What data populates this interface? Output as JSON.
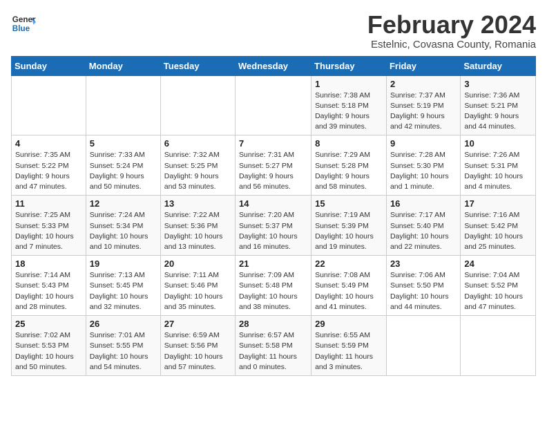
{
  "logo": {
    "line1": "General",
    "line2": "Blue"
  },
  "title": "February 2024",
  "subtitle": "Estelnic, Covasna County, Romania",
  "days_of_week": [
    "Sunday",
    "Monday",
    "Tuesday",
    "Wednesday",
    "Thursday",
    "Friday",
    "Saturday"
  ],
  "weeks": [
    [
      {
        "day": "",
        "info": ""
      },
      {
        "day": "",
        "info": ""
      },
      {
        "day": "",
        "info": ""
      },
      {
        "day": "",
        "info": ""
      },
      {
        "day": "1",
        "info": "Sunrise: 7:38 AM\nSunset: 5:18 PM\nDaylight: 9 hours\nand 39 minutes."
      },
      {
        "day": "2",
        "info": "Sunrise: 7:37 AM\nSunset: 5:19 PM\nDaylight: 9 hours\nand 42 minutes."
      },
      {
        "day": "3",
        "info": "Sunrise: 7:36 AM\nSunset: 5:21 PM\nDaylight: 9 hours\nand 44 minutes."
      }
    ],
    [
      {
        "day": "4",
        "info": "Sunrise: 7:35 AM\nSunset: 5:22 PM\nDaylight: 9 hours\nand 47 minutes."
      },
      {
        "day": "5",
        "info": "Sunrise: 7:33 AM\nSunset: 5:24 PM\nDaylight: 9 hours\nand 50 minutes."
      },
      {
        "day": "6",
        "info": "Sunrise: 7:32 AM\nSunset: 5:25 PM\nDaylight: 9 hours\nand 53 minutes."
      },
      {
        "day": "7",
        "info": "Sunrise: 7:31 AM\nSunset: 5:27 PM\nDaylight: 9 hours\nand 56 minutes."
      },
      {
        "day": "8",
        "info": "Sunrise: 7:29 AM\nSunset: 5:28 PM\nDaylight: 9 hours\nand 58 minutes."
      },
      {
        "day": "9",
        "info": "Sunrise: 7:28 AM\nSunset: 5:30 PM\nDaylight: 10 hours\nand 1 minute."
      },
      {
        "day": "10",
        "info": "Sunrise: 7:26 AM\nSunset: 5:31 PM\nDaylight: 10 hours\nand 4 minutes."
      }
    ],
    [
      {
        "day": "11",
        "info": "Sunrise: 7:25 AM\nSunset: 5:33 PM\nDaylight: 10 hours\nand 7 minutes."
      },
      {
        "day": "12",
        "info": "Sunrise: 7:24 AM\nSunset: 5:34 PM\nDaylight: 10 hours\nand 10 minutes."
      },
      {
        "day": "13",
        "info": "Sunrise: 7:22 AM\nSunset: 5:36 PM\nDaylight: 10 hours\nand 13 minutes."
      },
      {
        "day": "14",
        "info": "Sunrise: 7:20 AM\nSunset: 5:37 PM\nDaylight: 10 hours\nand 16 minutes."
      },
      {
        "day": "15",
        "info": "Sunrise: 7:19 AM\nSunset: 5:39 PM\nDaylight: 10 hours\nand 19 minutes."
      },
      {
        "day": "16",
        "info": "Sunrise: 7:17 AM\nSunset: 5:40 PM\nDaylight: 10 hours\nand 22 minutes."
      },
      {
        "day": "17",
        "info": "Sunrise: 7:16 AM\nSunset: 5:42 PM\nDaylight: 10 hours\nand 25 minutes."
      }
    ],
    [
      {
        "day": "18",
        "info": "Sunrise: 7:14 AM\nSunset: 5:43 PM\nDaylight: 10 hours\nand 28 minutes."
      },
      {
        "day": "19",
        "info": "Sunrise: 7:13 AM\nSunset: 5:45 PM\nDaylight: 10 hours\nand 32 minutes."
      },
      {
        "day": "20",
        "info": "Sunrise: 7:11 AM\nSunset: 5:46 PM\nDaylight: 10 hours\nand 35 minutes."
      },
      {
        "day": "21",
        "info": "Sunrise: 7:09 AM\nSunset: 5:48 PM\nDaylight: 10 hours\nand 38 minutes."
      },
      {
        "day": "22",
        "info": "Sunrise: 7:08 AM\nSunset: 5:49 PM\nDaylight: 10 hours\nand 41 minutes."
      },
      {
        "day": "23",
        "info": "Sunrise: 7:06 AM\nSunset: 5:50 PM\nDaylight: 10 hours\nand 44 minutes."
      },
      {
        "day": "24",
        "info": "Sunrise: 7:04 AM\nSunset: 5:52 PM\nDaylight: 10 hours\nand 47 minutes."
      }
    ],
    [
      {
        "day": "25",
        "info": "Sunrise: 7:02 AM\nSunset: 5:53 PM\nDaylight: 10 hours\nand 50 minutes."
      },
      {
        "day": "26",
        "info": "Sunrise: 7:01 AM\nSunset: 5:55 PM\nDaylight: 10 hours\nand 54 minutes."
      },
      {
        "day": "27",
        "info": "Sunrise: 6:59 AM\nSunset: 5:56 PM\nDaylight: 10 hours\nand 57 minutes."
      },
      {
        "day": "28",
        "info": "Sunrise: 6:57 AM\nSunset: 5:58 PM\nDaylight: 11 hours\nand 0 minutes."
      },
      {
        "day": "29",
        "info": "Sunrise: 6:55 AM\nSunset: 5:59 PM\nDaylight: 11 hours\nand 3 minutes."
      },
      {
        "day": "",
        "info": ""
      },
      {
        "day": "",
        "info": ""
      }
    ]
  ]
}
